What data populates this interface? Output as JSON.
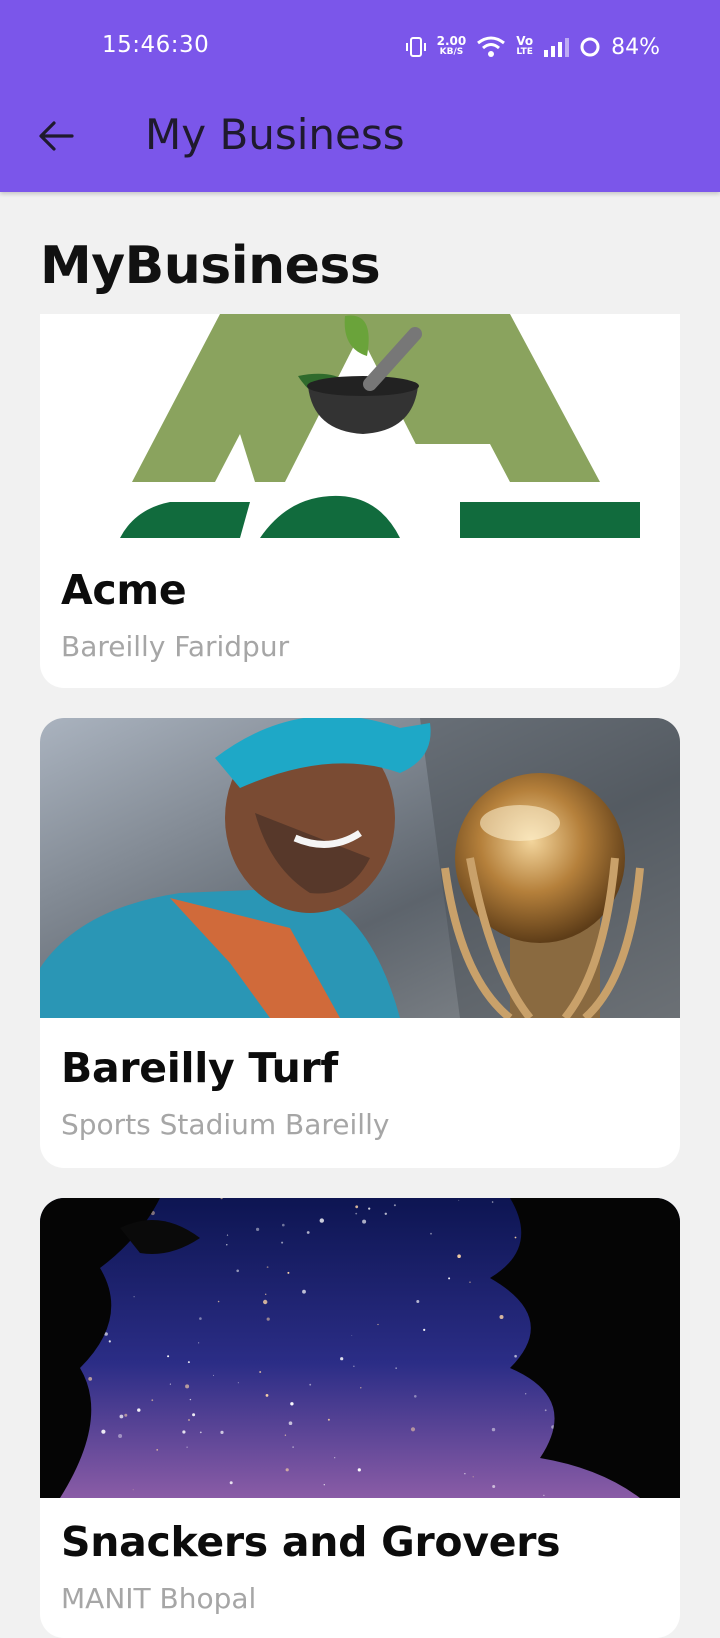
{
  "status_bar": {
    "time": "15:46:30",
    "data_rate_value": "2.00",
    "data_rate_unit": "KB/S",
    "network_label_top": "Vo",
    "network_label_bottom": "LTE",
    "battery": "84%"
  },
  "appbar": {
    "title": "My Business",
    "back_icon": "arrow-left-icon"
  },
  "page": {
    "heading": "MyBusiness"
  },
  "businesses": [
    {
      "name": "Acme",
      "location": "Bareilly Faridpur",
      "image": "acme-logo-image"
    },
    {
      "name": "Bareilly Turf",
      "location": "Sports Stadium Bareilly",
      "image": "cricket-player-with-trophy-image"
    },
    {
      "name": "Snackers and Grovers",
      "location": "MANIT Bhopal",
      "image": "starry-night-sky-image"
    }
  ],
  "colors": {
    "appbar": "#7b56ea",
    "background": "#f1f1f1",
    "card": "#ffffff",
    "subtitle": "#a6a6a6",
    "acme_green": "#8aa35e"
  }
}
